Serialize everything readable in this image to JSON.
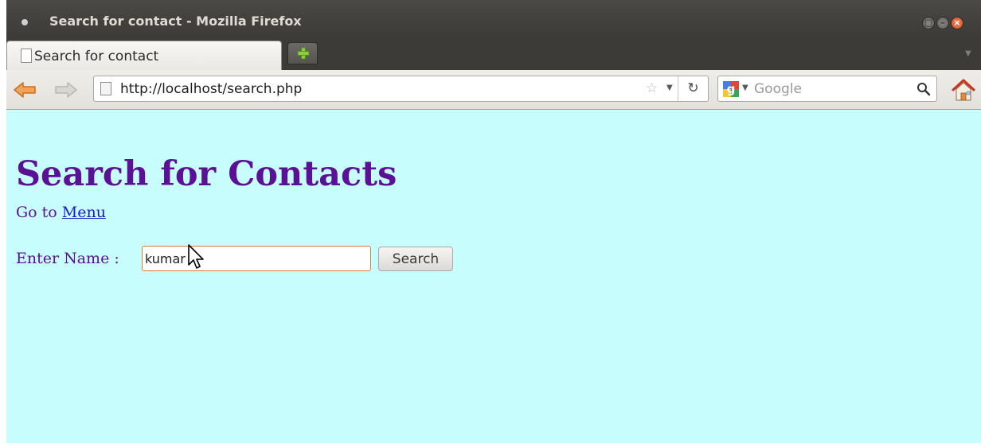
{
  "window": {
    "title": "Search for contact - Mozilla Firefox"
  },
  "tabs": [
    {
      "label": "Search for contact",
      "active": true
    }
  ],
  "navbar": {
    "url": "http://localhost/search.php",
    "search_placeholder": "Google",
    "icons": [
      "back-arrow-icon",
      "forward-arrow-icon",
      "page-icon",
      "bookmark-star-icon",
      "reload-icon",
      "google-icon",
      "magnifier-icon",
      "home-icon"
    ]
  },
  "page": {
    "heading": "Search for Contacts",
    "goto_prefix": "Go to",
    "goto_link": "Menu",
    "name_label": "Enter Name :",
    "name_value": "kumar",
    "search_button": "Search"
  },
  "colors": {
    "page_background": "#c8fdfd",
    "heading": "#5b1196",
    "link": "#1a1acc",
    "input_focus_border": "#e07a3a",
    "titlebar": "#3c3b37"
  }
}
